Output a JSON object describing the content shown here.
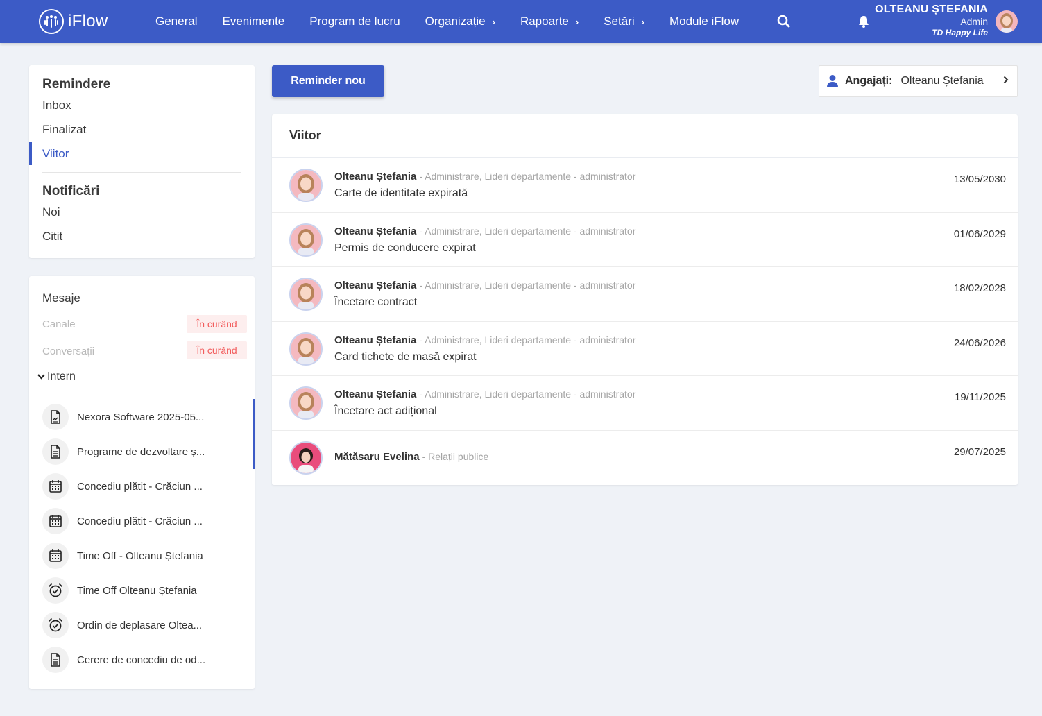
{
  "app": {
    "name": "iFlow"
  },
  "nav": {
    "items": [
      {
        "label": "General",
        "has_sub": false
      },
      {
        "label": "Evenimente",
        "has_sub": false
      },
      {
        "label": "Program de lucru",
        "has_sub": false
      },
      {
        "label": "Organizație",
        "has_sub": true
      },
      {
        "label": "Rapoarte",
        "has_sub": true
      },
      {
        "label": "Setări",
        "has_sub": true
      },
      {
        "label": "Module iFlow",
        "has_sub": false
      }
    ]
  },
  "user": {
    "name": "OLTEANU ȘTEFANIA",
    "role": "Admin",
    "company": "TD Happy Life"
  },
  "sidebar": {
    "reminders_title": "Remindere",
    "reminders": [
      {
        "label": "Inbox",
        "active": false
      },
      {
        "label": "Finalizat",
        "active": false
      },
      {
        "label": "Viitor",
        "active": true
      }
    ],
    "notifications_title": "Notificări",
    "notifications": [
      {
        "label": "Noi"
      },
      {
        "label": "Citit"
      }
    ]
  },
  "messages": {
    "title": "Mesaje",
    "disabled": [
      {
        "label": "Canale",
        "badge": "În curând"
      },
      {
        "label": "Conversații",
        "badge": "În curând"
      }
    ],
    "group_label": "Intern",
    "items": [
      {
        "label": "Nexora Software 2025-05...",
        "icon": "signed-document-icon"
      },
      {
        "label": "Programe de dezvoltare ș...",
        "icon": "document-icon"
      },
      {
        "label": "Concediu plătit - Crăciun ...",
        "icon": "calendar-icon"
      },
      {
        "label": "Concediu plătit - Crăciun ...",
        "icon": "calendar-icon"
      },
      {
        "label": "Time Off - Olteanu Ștefania",
        "icon": "calendar-icon"
      },
      {
        "label": "Time Off Olteanu Ștefania",
        "icon": "alarm-check-icon"
      },
      {
        "label": "Ordin de deplasare Oltea...",
        "icon": "alarm-check-icon"
      },
      {
        "label": "Cerere de concediu de od...",
        "icon": "document-icon"
      }
    ]
  },
  "toolbar": {
    "new_reminder_label": "Reminder nou",
    "employee_label": "Angajați:",
    "employee_value": "Olteanu Ștefania"
  },
  "list": {
    "title": "Viitor",
    "rows": [
      {
        "name": "Olteanu Ștefania",
        "dept": "- Administrare, Lideri departamente - administrator",
        "title": "Carte de identitate expirată",
        "date": "13/05/2030",
        "avatar": "avatar-stefania"
      },
      {
        "name": "Olteanu Ștefania",
        "dept": "- Administrare, Lideri departamente - administrator",
        "title": "Permis de conducere expirat",
        "date": "01/06/2029",
        "avatar": "avatar-stefania"
      },
      {
        "name": "Olteanu Ștefania",
        "dept": "- Administrare, Lideri departamente - administrator",
        "title": "Încetare contract",
        "date": "18/02/2028",
        "avatar": "avatar-stefania"
      },
      {
        "name": "Olteanu Ștefania",
        "dept": "- Administrare, Lideri departamente - administrator",
        "title": "Card tichete de masă expirat",
        "date": "24/06/2026",
        "avatar": "avatar-stefania"
      },
      {
        "name": "Olteanu Ștefania",
        "dept": "- Administrare, Lideri departamente - administrator",
        "title": "Încetare act adițional",
        "date": "19/11/2025",
        "avatar": "avatar-stefania"
      },
      {
        "name": "Mătăsaru Evelina",
        "dept": "- Relații publice",
        "title": "",
        "date": "29/07/2025",
        "avatar": "avatar-evelina"
      }
    ]
  },
  "colors": {
    "accent": "#3c5bc6",
    "badge_text": "#f25c5c",
    "badge_bg": "#fdeeee",
    "page_bg": "#eff2f7"
  }
}
